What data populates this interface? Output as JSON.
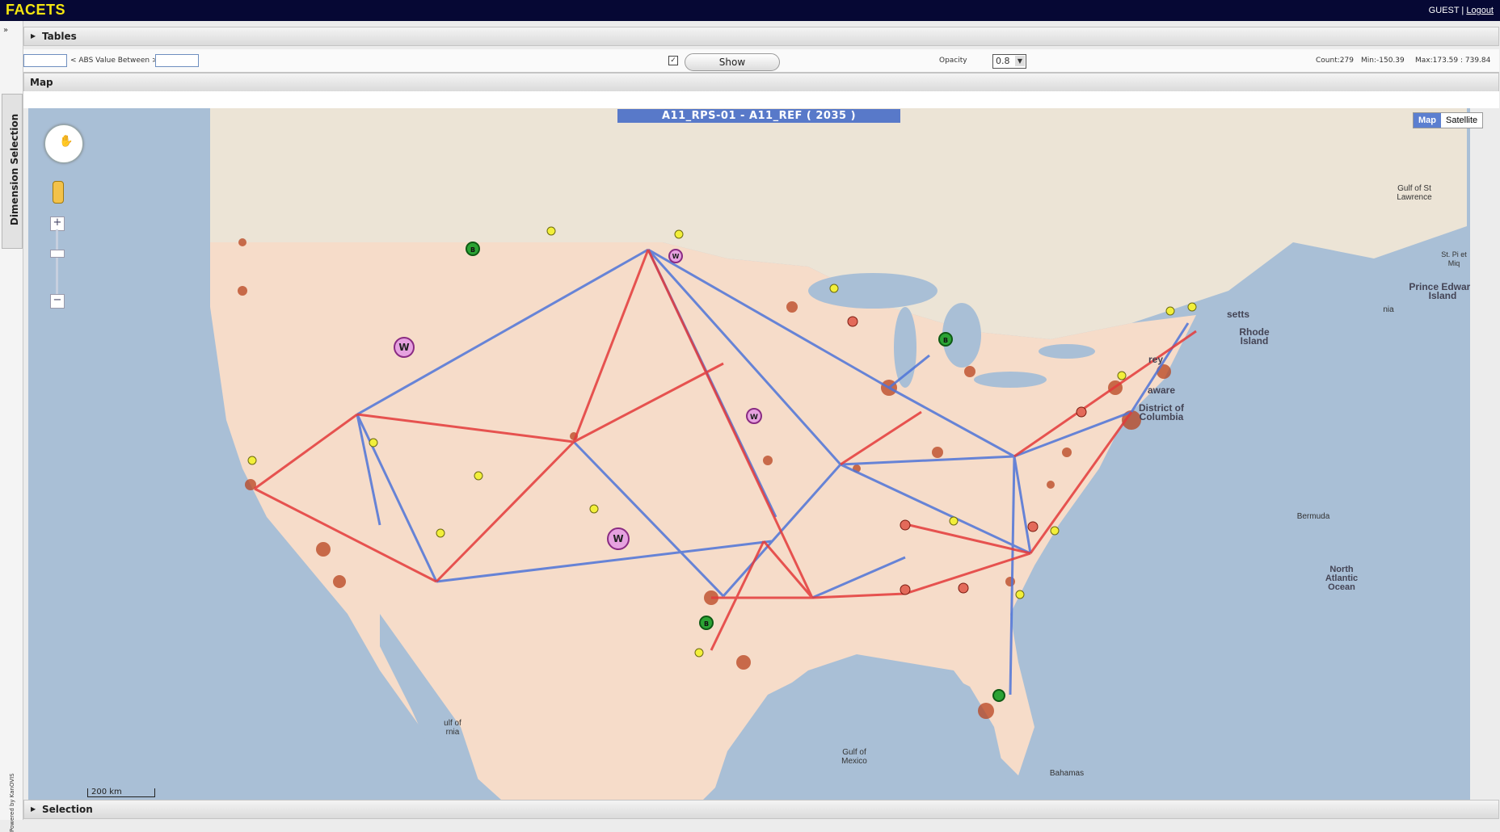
{
  "app": {
    "logo": "FACETS",
    "user": "GUEST",
    "logout": "Logout",
    "separator": "|"
  },
  "sidebar": {
    "tab_label": "Dimension Selection",
    "powered_by": "Powered by KanOVIS",
    "collapse_icon": "»"
  },
  "panels": {
    "tables": "Tables",
    "map": "Map",
    "selection": "Selection"
  },
  "filter": {
    "abs_label": "< ABS Value Between >",
    "show_label": "Show",
    "checked_mark": "✓",
    "opacity_label": "Opacity",
    "opacity_value": "0.8",
    "count": "Count:279",
    "min": "Min:-150.39",
    "max": "Max:173.59 : 739.84"
  },
  "map": {
    "title": "A11_RPS-01 - A11_REF ( 2035 )",
    "type_map": "Map",
    "type_satellite": "Satellite",
    "scale": "200 km",
    "labels": {
      "gulf_st_lawrence": "Gulf of St Lawrence",
      "st_pierre": "St. Pi et Miq",
      "pei": "Prince Edward Island",
      "rhode_island": "Rhode Island",
      "massachusetts": "setts",
      "jersey": "rey",
      "delaware": "aware",
      "dc": "District of Columbia",
      "bermuda": "Bermuda",
      "atlantic": "North Atlantic Ocean",
      "gulf_mexico": "Gulf of Mexico",
      "gulf_california": "ulf of rnia",
      "bahamas": "Bahamas",
      "nia": "nia"
    },
    "colors": {
      "water": "#a9bfd6",
      "land": "#f6dcc9",
      "canada": "#ece4d6",
      "positive_flow": "#e43a3a",
      "negative_flow": "#4e74d9"
    },
    "marker_icon_names": [
      "balloon-b-green-icon",
      "balloon-w-yellow-icon",
      "balloon-w-purple-icon",
      "balloon-n-red-icon",
      "balloon-s-red-icon"
    ]
  }
}
